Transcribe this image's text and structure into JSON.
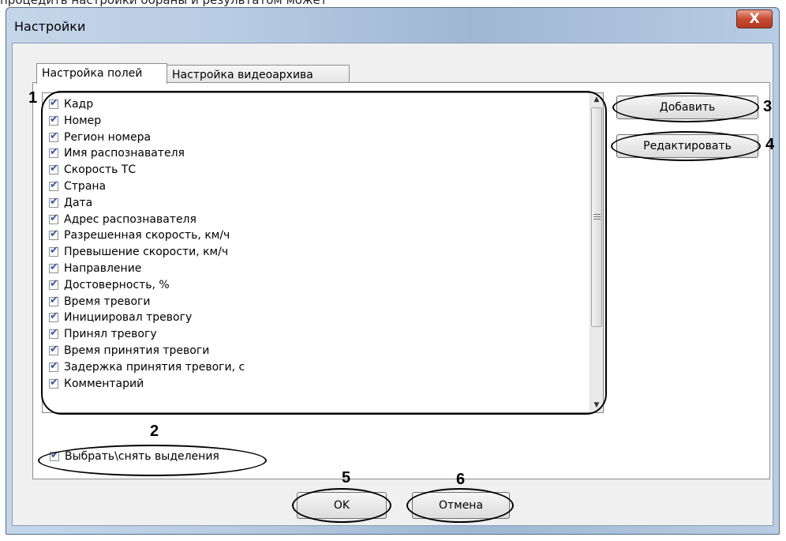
{
  "cut_off_top_text": "процедить настройки обраны и результатом может",
  "dialog": {
    "title": "Настройки",
    "close_glyph": "X"
  },
  "tabs": [
    {
      "label": "Настройка полей",
      "active": true
    },
    {
      "label": "Настройка видеоархива",
      "active": false
    }
  ],
  "fields": [
    {
      "label": "Кадр",
      "checked": true
    },
    {
      "label": "Номер",
      "checked": true
    },
    {
      "label": "Регион номера",
      "checked": true
    },
    {
      "label": "Имя распознавателя",
      "checked": true
    },
    {
      "label": "Скорость ТС",
      "checked": true
    },
    {
      "label": "Страна",
      "checked": true
    },
    {
      "label": "Дата",
      "checked": true
    },
    {
      "label": "Адрес распознавателя",
      "checked": true
    },
    {
      "label": "Разрешенная скорость, км/ч",
      "checked": true
    },
    {
      "label": "Превышение скорости, км/ч",
      "checked": true
    },
    {
      "label": "Направление",
      "checked": true
    },
    {
      "label": "Достоверность, %",
      "checked": true
    },
    {
      "label": "Время тревоги",
      "checked": true
    },
    {
      "label": "Инициировал тревогу",
      "checked": true
    },
    {
      "label": "Принял тревогу",
      "checked": true
    },
    {
      "label": "Время принятия тревоги",
      "checked": true
    },
    {
      "label": "Задержка принятия тревоги, с",
      "checked": true
    },
    {
      "label": "Комментарий",
      "checked": true
    }
  ],
  "buttons": {
    "add": "Добавить",
    "edit": "Редактировать",
    "ok": "OK",
    "cancel": "Отмена"
  },
  "select_all": {
    "label": "Выбрать\\снять  выделения",
    "checked": true
  },
  "callouts": {
    "list": "1",
    "select_all": "2",
    "add": "3",
    "edit": "4",
    "ok": "5",
    "cancel": "6"
  },
  "colors": {
    "close_button": "#c84b33",
    "checkmark": "#3a55a0",
    "window_frame": "#b7cbe2"
  }
}
